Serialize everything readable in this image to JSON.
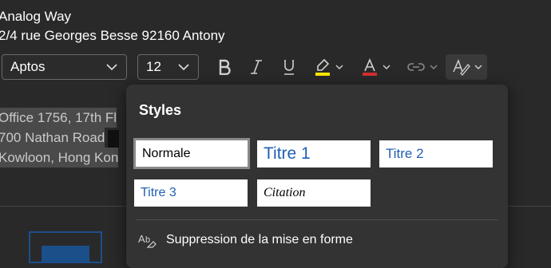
{
  "document": {
    "line1": "Analog Way",
    "line2": "2/4 rue Georges Besse 92160 Antony",
    "selected_lines": [
      "Office 1756, 17th Fl",
      "700 Nathan Road",
      "Kowloon, Hong Kon"
    ]
  },
  "toolbar": {
    "font_family": "Aptos",
    "font_size": "12",
    "bold_icon": "bold-icon",
    "italic_icon": "italic-icon",
    "underline_icon": "underline-icon",
    "highlight_color": "#ffe600",
    "font_color": "#d32f2f",
    "link_icon": "link-icon",
    "styles_icon": "styles-icon"
  },
  "styles_panel": {
    "title": "Styles",
    "tiles": [
      {
        "label": "Normale",
        "selected": true
      },
      {
        "label": "Titre 1"
      },
      {
        "label": "Titre 2"
      },
      {
        "label": "Titre 3"
      },
      {
        "label": "Citation"
      }
    ],
    "clear_formatting": "Suppression de la mise en forme"
  },
  "colors": {
    "background": "#292929",
    "panel": "#333333",
    "heading_blue": "#1f5fb3"
  }
}
